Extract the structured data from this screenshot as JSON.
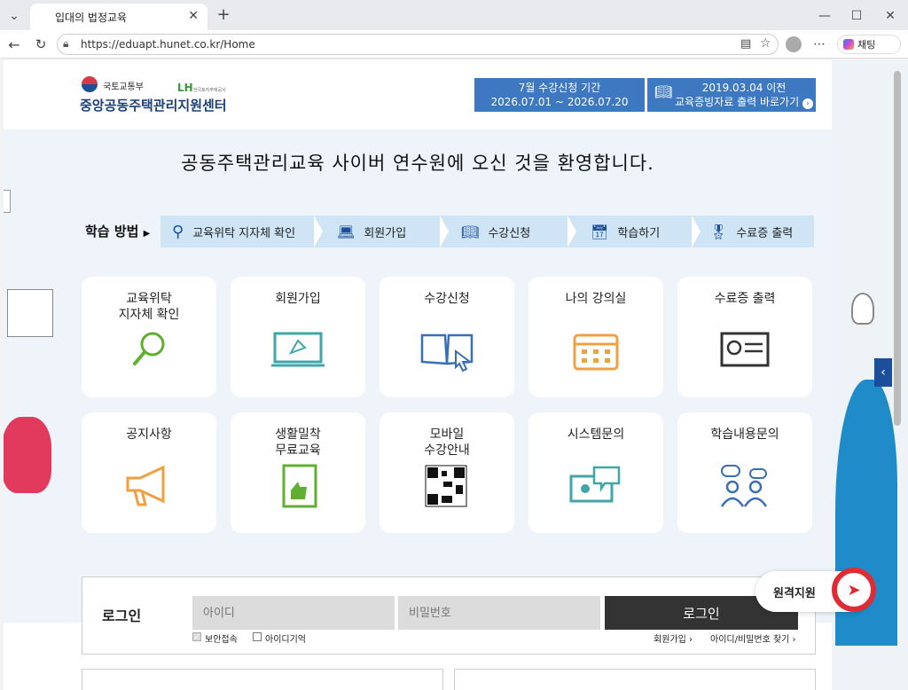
{
  "browser": {
    "tab_title": "입대의 법정교육",
    "url": "https://eduapt.hunet.co.kr/Home",
    "chat_label": "채팅"
  },
  "header": {
    "ministry": "국토교통부",
    "center": "중앙공동주택관리지원센터",
    "lh_logo": "LH",
    "lh_sub": "한국토지주택공사",
    "notice1": {
      "line1": "7월 수강신청 기간",
      "line2": "2026.07.01 ~ 2026.07.20"
    },
    "notice2": {
      "line1": "2019.03.04 이전",
      "line2": "교육증빙자료 출력 바로가기"
    }
  },
  "hero": {
    "welcome": "공동주택관리교육 사이버 연수원에 오신 것을 환영합니다.",
    "steps_label": "학습 방법",
    "steps": [
      "교육위탁 지자체 확인",
      "회원가입",
      "수강신청",
      "학습하기",
      "수료증 출력"
    ]
  },
  "cards": [
    {
      "label": "교육위탁\n지자체 확인",
      "icon": "magnifier-icon"
    },
    {
      "label": "회원가입",
      "icon": "laptop-puzzle-icon"
    },
    {
      "label": "수강신청",
      "icon": "book-cursor-icon"
    },
    {
      "label": "나의 강의실",
      "icon": "calendar-icon"
    },
    {
      "label": "수료증 출력",
      "icon": "certificate-icon"
    },
    {
      "label": "공지사항",
      "icon": "megaphone-icon"
    },
    {
      "label": "생활밀착\n무료교육",
      "icon": "book-thumb-icon"
    },
    {
      "label": "모바일\n수강안내",
      "icon": "qr-code-icon"
    },
    {
      "label": "시스템문의",
      "icon": "monitor-chat-icon"
    },
    {
      "label": "학습내용문의",
      "icon": "people-chat-icon"
    }
  ],
  "login": {
    "title": "로그인",
    "id_placeholder": "아이디",
    "pw_placeholder": "비밀번호",
    "button": "로그인",
    "secure": "보안접속",
    "remember": "아이디기억",
    "join": "회원가입",
    "find": "아이디/비밀번호 찾기"
  },
  "remote": {
    "label": "원격지원"
  }
}
